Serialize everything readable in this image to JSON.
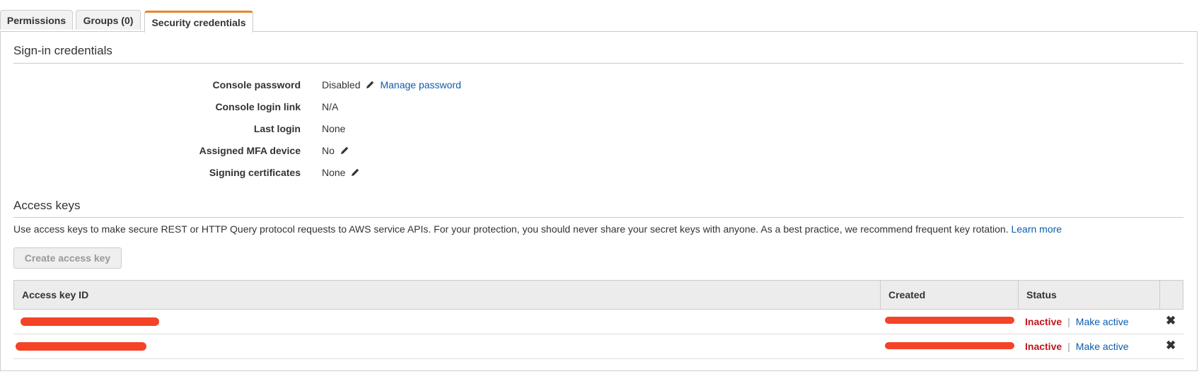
{
  "tabs": [
    {
      "label": "Permissions"
    },
    {
      "label": "Groups (0)"
    },
    {
      "label": "Security credentials"
    }
  ],
  "signin": {
    "title": "Sign-in credentials",
    "rows": [
      {
        "label": "Console password",
        "value": "Disabled",
        "link": "Manage password"
      },
      {
        "label": "Console login link",
        "value": "N/A"
      },
      {
        "label": "Last login",
        "value": "None"
      },
      {
        "label": "Assigned MFA device",
        "value": "No"
      },
      {
        "label": "Signing certificates",
        "value": "None"
      }
    ]
  },
  "access_keys": {
    "title": "Access keys",
    "description": "Use access keys to make secure REST or HTTP Query protocol requests to AWS service APIs. For your protection, you should never share your secret keys with anyone. As a best practice, we recommend frequent key rotation.",
    "learn_more": "Learn more",
    "create_button": "Create access key",
    "columns": [
      "Access key ID",
      "Created",
      "Status"
    ],
    "rows": [
      {
        "status": "Inactive",
        "action": "Make active"
      },
      {
        "status": "Inactive",
        "action": "Make active"
      }
    ]
  },
  "colors": {
    "accent": "#e8842a",
    "link": "#0b5dad",
    "inactive": "#c0171c",
    "redaction": "#f44326"
  }
}
